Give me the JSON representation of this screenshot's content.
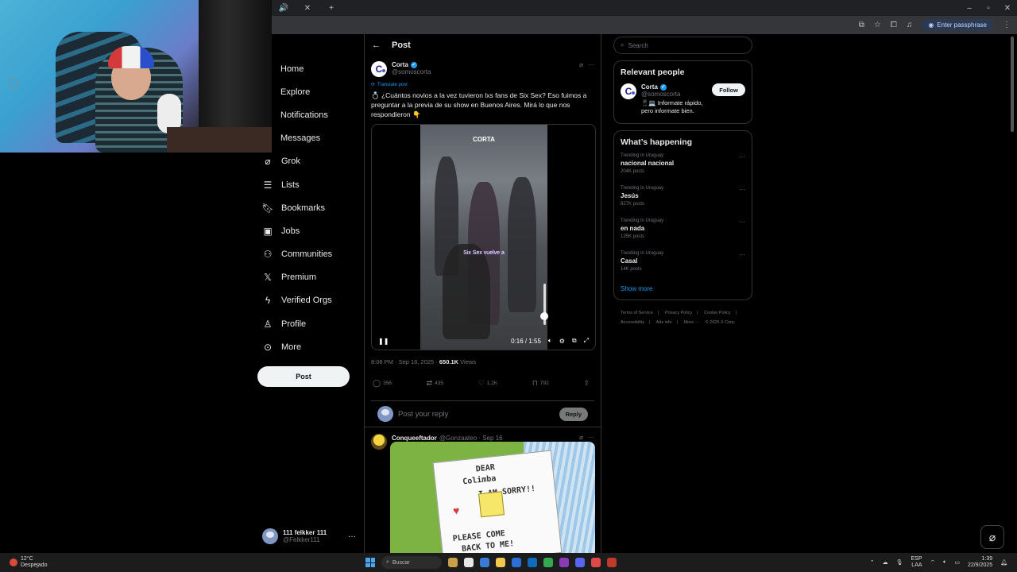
{
  "browser": {
    "passphrase_label": "Enter passphrase",
    "window_controls": [
      "–",
      "▫",
      "✕"
    ]
  },
  "nav": {
    "items": [
      {
        "label": "Home",
        "icon": "home-icon"
      },
      {
        "label": "Explore",
        "icon": "search-icon"
      },
      {
        "label": "Notifications",
        "icon": "bell-icon"
      },
      {
        "label": "Messages",
        "icon": "mail-icon"
      },
      {
        "label": "Grok",
        "icon": "grok-icon"
      },
      {
        "label": "Lists",
        "icon": "list-icon"
      },
      {
        "label": "Bookmarks",
        "icon": "bookmark-icon"
      },
      {
        "label": "Jobs",
        "icon": "briefcase-icon"
      },
      {
        "label": "Communities",
        "icon": "people-icon"
      },
      {
        "label": "Premium",
        "icon": "x-logo-icon"
      },
      {
        "label": "Verified Orgs",
        "icon": "lightning-icon"
      },
      {
        "label": "Profile",
        "icon": "person-icon"
      },
      {
        "label": "More",
        "icon": "more-circle-icon"
      }
    ],
    "post_button": "Post"
  },
  "account": {
    "name": "111 felkker 111",
    "handle": "@Felkker111"
  },
  "main": {
    "header_title": "Post",
    "post": {
      "author_name": "Corta",
      "author_handle": "@somoscorta",
      "translate_label": "Translate post",
      "text": "💍 ¿Cuántos novios a la vez tuvieron lxs fans de Six Sex? Eso fuimos a preguntar a la previa de su show en Buenos Aires. Mirá lo que nos respondieron 👇",
      "video": {
        "watermark": "CORTA",
        "subtitle": "Six Sex vuelve a",
        "time": "0:16 / 1:55"
      },
      "timestamp": "8:08 PM · Sep 16, 2025 · ",
      "views_count": "650.1K",
      "views_label": " Views",
      "stats": {
        "replies": "356",
        "reposts": "435",
        "likes": "1.2K",
        "bookmarks": "792"
      }
    },
    "reply_box": {
      "placeholder": "Post your reply",
      "button": "Reply"
    },
    "reply": {
      "author_name": "Conqueeftador",
      "meta": "@Gonzaateo · Sep 16",
      "image_text": [
        "DEAR",
        "Colimba",
        "I AM SORRY!!",
        "PLEASE COME",
        "BACK TO ME!"
      ]
    }
  },
  "right": {
    "search_placeholder": "Search",
    "relevant": {
      "title": "Relevant people",
      "name": "Corta",
      "handle": "@somoscorta",
      "bio": "📱💻 Informate rápido, pero informate bien.",
      "follow": "Follow"
    },
    "happening": {
      "title": "What’s happening",
      "trends": [
        {
          "context": "Trending in Uruguay",
          "topic": "nacional nacional",
          "count": "204K posts"
        },
        {
          "context": "Trending in Uruguay",
          "topic": "Jesús",
          "count": "827K posts"
        },
        {
          "context": "Trending in Uruguay",
          "topic": "en nada",
          "count": "135K posts"
        },
        {
          "context": "Trending in Uruguay",
          "topic": "Casal",
          "count": "14K posts"
        }
      ],
      "show_more": "Show more"
    },
    "footer": [
      "Terms of Service",
      "|",
      "Privacy Policy",
      "|",
      "Cookie Policy",
      "|",
      "Accessibility",
      "|",
      "Ads info",
      "|",
      "More ···",
      "© 2025 X Corp."
    ]
  },
  "taskbar": {
    "temp": "12°C",
    "weather": "Despejado",
    "search": "Buscar",
    "lang": "ESP",
    "lang2": "LAA",
    "time": "1:39",
    "date": "22/9/2025"
  }
}
